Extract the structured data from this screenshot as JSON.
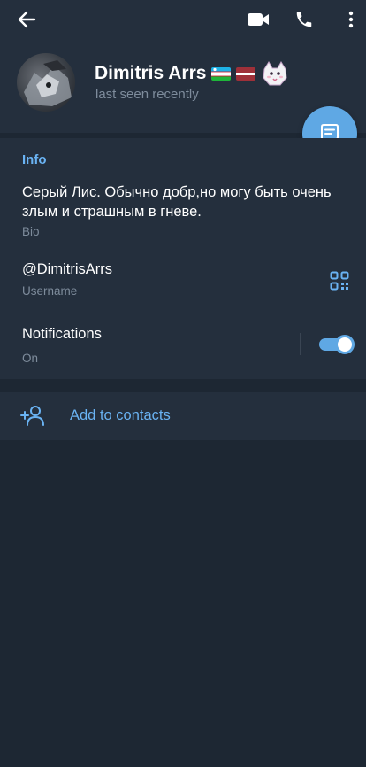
{
  "profile": {
    "name": "Dimitris Arrs",
    "status": "last seen recently"
  },
  "topbar": {
    "icons": [
      "back-arrow-icon",
      "video-call-icon",
      "phone-icon",
      "more-vertical-icon"
    ]
  },
  "info": {
    "title": "Info",
    "bio": "Серый Лис. Обычно добр,но могу быть очень злым и страшным в гневе.",
    "bio_caption": "Bio",
    "username": "@DimitrisArrs",
    "username_caption": "Username",
    "notifications_label": "Notifications",
    "notifications_state": "On",
    "notifications_enabled": true
  },
  "actions": {
    "add_to_contacts": "Add to contacts"
  },
  "colors": {
    "background": "#1d2733",
    "card": "#242f3d",
    "accent": "#6ab3f3",
    "fab": "#5fa8e4",
    "secondary_text": "#7e8c9c"
  }
}
